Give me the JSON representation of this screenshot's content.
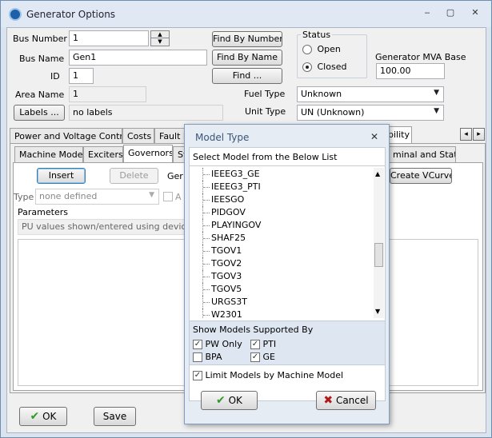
{
  "window": {
    "title": "Generator Options",
    "minimize": "‒",
    "maximize": "▢",
    "close": "✕"
  },
  "header": {
    "bus_number_label": "Bus Number",
    "bus_number": "1",
    "bus_name_label": "Bus Name",
    "bus_name": "Gen1",
    "id_label": "ID",
    "id": "1",
    "area_name_label": "Area Name",
    "area_name": "1",
    "labels_button": "Labels ...",
    "labels_value": "no labels",
    "find_by_number": "Find By Number",
    "find_by_name": "Find By Name",
    "find": "Find ...",
    "status_label": "Status",
    "status_open": "Open",
    "status_closed": "Closed",
    "mva_label": "Generator MVA Base",
    "mva_value": "100.00",
    "fuel_type_label": "Fuel Type",
    "fuel_type": "Unknown",
    "unit_type_label": "Unit Type",
    "unit_type": "UN (Unknown)"
  },
  "tabs": {
    "power_voltage": "Power and Voltage Control",
    "costs": "Costs",
    "fault": "Fault P",
    "bility": "bility",
    "scroll_left": "◂",
    "scroll_right": "▸"
  },
  "subtabs": {
    "machine_models": "Machine Models",
    "exciters": "Exciters",
    "governors": "Governors",
    "st": "St",
    "terminal": "minal and State"
  },
  "governors": {
    "insert": "Insert",
    "delete": "Delete",
    "gen_partial": "Ger",
    "create_vcurve": "Create VCurve",
    "type_label": "Type",
    "type_value": "none defined",
    "a_partial": "A",
    "parameters_label": "Parameters",
    "pu_note": "PU values shown/entered using device ba"
  },
  "footer": {
    "ok": "OK",
    "save": "Save"
  },
  "dialog": {
    "title": "Model Type",
    "close": "✕",
    "instruction": "Select Model from the Below List",
    "models": [
      "IEEEG3_GE",
      "IEEEG3_PTI",
      "IEESGO",
      "PIDGOV",
      "PLAYINGOV",
      "SHAF25",
      "TGOV1",
      "TGOV2",
      "TGOV3",
      "TGOV5",
      "URGS3T",
      "W2301"
    ],
    "show_models_label": "Show Models Supported By",
    "pw_only": "PW Only",
    "pti": "PTI",
    "bpa": "BPA",
    "ge": "GE",
    "limit_models": "Limit Models by Machine Model",
    "ok": "OK",
    "cancel": "Cancel"
  }
}
